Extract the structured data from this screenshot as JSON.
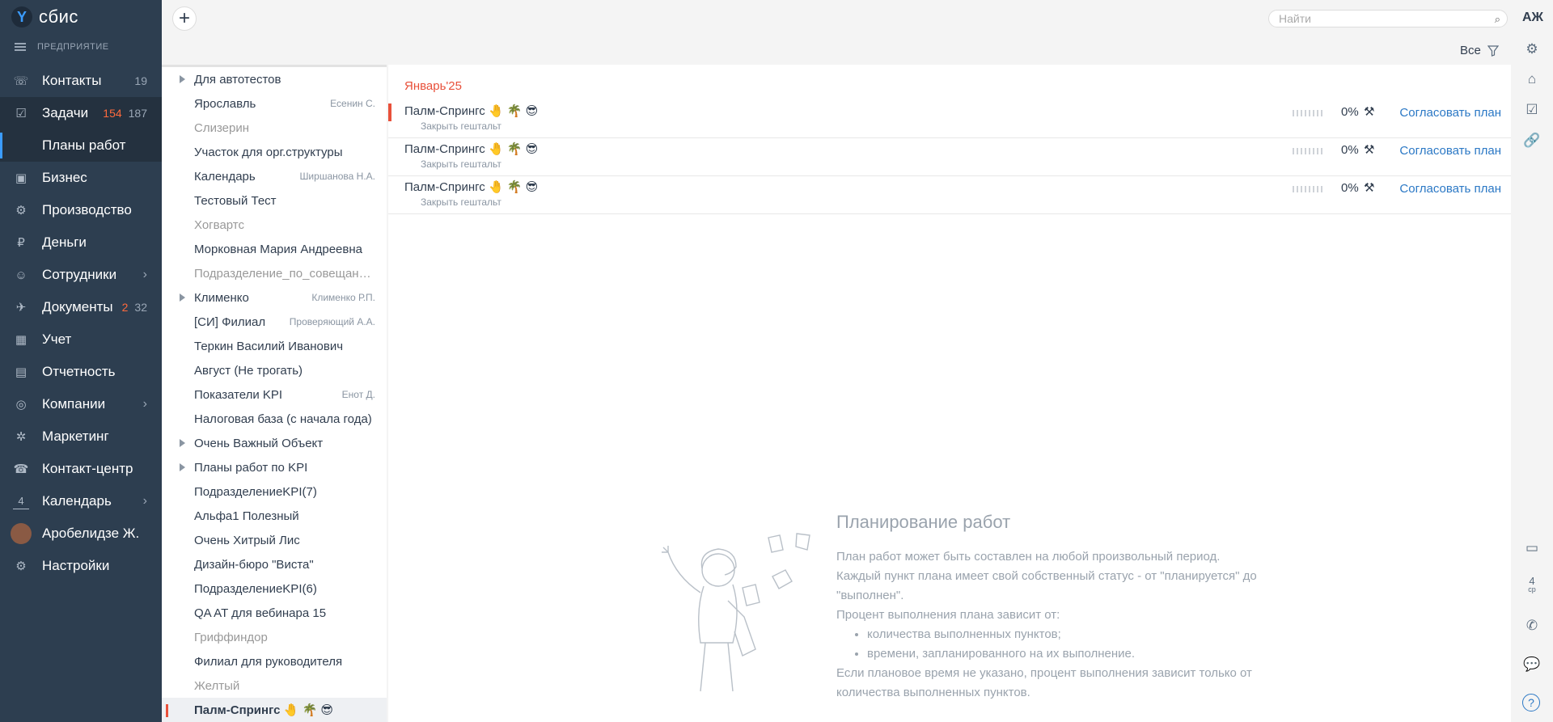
{
  "app": {
    "logo_text": "сбис",
    "company": "ПРЕДПРИЯТИЕ",
    "user_initials": "АЖ"
  },
  "search": {
    "placeholder": "Найти"
  },
  "filter": {
    "label": "Все"
  },
  "nav": [
    {
      "label": "Контакты",
      "icon": "contacts-icon",
      "count": "19"
    },
    {
      "label": "Задачи",
      "icon": "tasks-icon",
      "count_red": "154",
      "count": "187",
      "active": true
    },
    {
      "label": "Планы работ",
      "sub": true
    },
    {
      "label": "Бизнес",
      "icon": "business-icon"
    },
    {
      "label": "Производство",
      "icon": "production-icon"
    },
    {
      "label": "Деньги",
      "icon": "money-icon"
    },
    {
      "label": "Сотрудники",
      "icon": "employees-icon",
      "chevron": true
    },
    {
      "label": "Документы",
      "icon": "documents-icon",
      "count_red": "2",
      "count": "32"
    },
    {
      "label": "Учет",
      "icon": "accounting-icon"
    },
    {
      "label": "Отчетность",
      "icon": "reporting-icon"
    },
    {
      "label": "Компании",
      "icon": "companies-icon",
      "chevron": true
    },
    {
      "label": "Маркетинг",
      "icon": "marketing-icon"
    },
    {
      "label": "Контакт-центр",
      "icon": "contact-center-icon"
    },
    {
      "label": "Календарь",
      "icon": "calendar-icon",
      "chevron": true,
      "icon_text": "4"
    },
    {
      "label": "Аробелидзе Ж.",
      "icon": "avatar"
    },
    {
      "label": "Настройки",
      "icon": "settings-icon"
    }
  ],
  "folders": [
    {
      "label": "Для автотестов",
      "arrow": true
    },
    {
      "label": "Ярославль",
      "owner": "Есенин С."
    },
    {
      "label": "Слизерин",
      "muted": true
    },
    {
      "label": "Участок для орг.структуры"
    },
    {
      "label": "Календарь",
      "owner": "Ширшанова Н.А."
    },
    {
      "label": "Тестовый Тест"
    },
    {
      "label": "Хогвартс",
      "muted": true
    },
    {
      "label": "Морковная Мария Андреевна"
    },
    {
      "label": "Подразделение_по_совещаниям",
      "muted": true
    },
    {
      "label": "Клименко",
      "owner": "Клименко Р.П.",
      "arrow": true
    },
    {
      "label": "[СИ] Филиал",
      "owner": "Проверяющий А.А."
    },
    {
      "label": "Теркин Василий Иванович"
    },
    {
      "label": "Август (Не трогать)"
    },
    {
      "label": "Показатели KPI",
      "owner": "Енот Д."
    },
    {
      "label": "Налоговая база (с начала года)"
    },
    {
      "label": "Очень Важный Объект",
      "arrow": true
    },
    {
      "label": "Планы работ по KPI",
      "arrow": true
    },
    {
      "label": "ПодразделениеKPI(7)"
    },
    {
      "label": "Альфа1 Полезный"
    },
    {
      "label": "Очень Хитрый Лис"
    },
    {
      "label": "Дизайн-бюро \"Виста\""
    },
    {
      "label": "ПодразделениеKPI(6)"
    },
    {
      "label": "QA AT для вебинара 15"
    },
    {
      "label": "Гриффиндор",
      "muted": true
    },
    {
      "label": "Филиал для руководителя"
    },
    {
      "label": "Желтый",
      "muted": true
    },
    {
      "label": "Палм-Спрингс 🤚 🌴 😎",
      "selected": true
    }
  ],
  "main": {
    "month": "Январь'25",
    "plans": [
      {
        "title": "Палм-Спрингс 🤚 🌴 😎",
        "subtitle": "Закрыть гештальт",
        "progress": 0,
        "percent": "0%",
        "action": "Согласовать план"
      },
      {
        "title": "Палм-Спрингс 🤚 🌴 😎",
        "subtitle": "Закрыть гештальт",
        "progress": 0,
        "percent": "0%",
        "action": "Согласовать план"
      },
      {
        "title": "Палм-Спрингс 🤚 🌴 😎",
        "subtitle": "Закрыть гештальт",
        "progress": 0,
        "percent": "0%",
        "action": "Согласовать план"
      }
    ],
    "info": {
      "title": "Планирование работ",
      "p1": "План работ может быть составлен на любой произвольный период. Каждый пункт плана имеет свой собственный статус - от \"планируется\" до \"выполнен\".",
      "p2": "Процент выполнения плана зависит от:",
      "bullets": [
        "количества выполненных пунктов;",
        "времени, запланированного на их выполнение."
      ],
      "p3": "Если плановое время не указано, процент выполнения зависит только от количества выполненных пунктов."
    }
  },
  "rail": {
    "calendar_day": "4",
    "calendar_weekday": "ср"
  }
}
